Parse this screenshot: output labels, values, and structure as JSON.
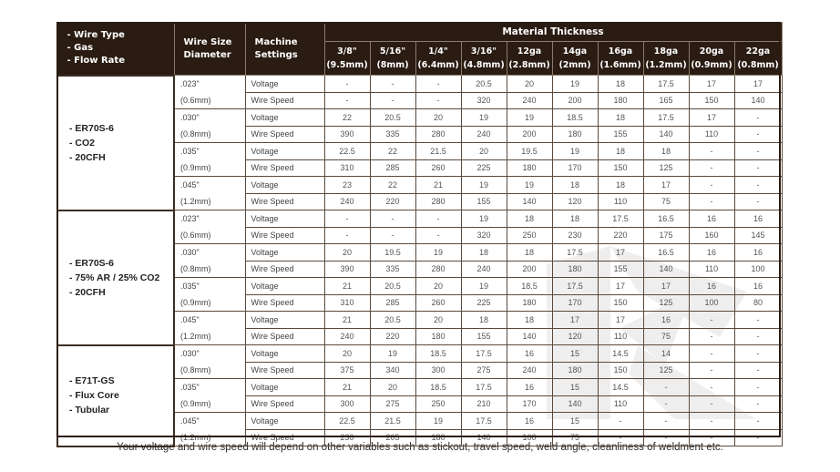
{
  "header": {
    "col1_lines": [
      "- Wire Type",
      "- Gas",
      "- Flow Rate"
    ],
    "col2_lines": [
      "Wire Size",
      "Diameter"
    ],
    "col3_lines": [
      "Machine",
      "Settings"
    ],
    "group_title": "Material Thickness",
    "thickness": [
      {
        "label": "3/8\"",
        "sub": "(9.5mm)"
      },
      {
        "label": "5/16\"",
        "sub": "(8mm)"
      },
      {
        "label": "1/4\"",
        "sub": "(6.4mm)"
      },
      {
        "label": "3/16\"",
        "sub": "(4.8mm)"
      },
      {
        "label": "12ga",
        "sub": "(2.8mm)"
      },
      {
        "label": "14ga",
        "sub": "(2mm)"
      },
      {
        "label": "16ga",
        "sub": "(1.6mm)"
      },
      {
        "label": "18ga",
        "sub": "(1.2mm)"
      },
      {
        "label": "20ga",
        "sub": "(0.9mm)"
      },
      {
        "label": "22ga",
        "sub": "(0.8mm)"
      }
    ]
  },
  "setting_labels": {
    "voltage": "Voltage",
    "wire_speed": "Wire Speed"
  },
  "groups": [
    {
      "lines": [
        "- ER70S-6",
        "- CO2",
        "- 20CFH"
      ],
      "sizes": [
        {
          "in": ".023\"",
          "mm": "(0.6mm)",
          "voltage": [
            "-",
            "-",
            "-",
            "20.5",
            "20",
            "19",
            "18",
            "17.5",
            "17",
            "17"
          ],
          "wire_speed": [
            "-",
            "-",
            "-",
            "320",
            "240",
            "200",
            "180",
            "165",
            "150",
            "140"
          ]
        },
        {
          "in": ".030\"",
          "mm": "(0.8mm)",
          "voltage": [
            "22",
            "20.5",
            "20",
            "19",
            "19",
            "18.5",
            "18",
            "17.5",
            "17",
            "-"
          ],
          "wire_speed": [
            "390",
            "335",
            "280",
            "240",
            "200",
            "180",
            "155",
            "140",
            "110",
            "-"
          ]
        },
        {
          "in": ".035\"",
          "mm": "(0.9mm)",
          "voltage": [
            "22.5",
            "22",
            "21.5",
            "20",
            "19.5",
            "19",
            "18",
            "18",
            "-",
            "-"
          ],
          "wire_speed": [
            "310",
            "285",
            "260",
            "225",
            "180",
            "170",
            "150",
            "125",
            "-",
            "-"
          ]
        },
        {
          "in": ".045\"",
          "mm": "(1.2mm)",
          "voltage": [
            "23",
            "22",
            "21",
            "19",
            "19",
            "18",
            "18",
            "17",
            "-",
            "-"
          ],
          "wire_speed": [
            "240",
            "220",
            "280",
            "155",
            "140",
            "120",
            "110",
            "75",
            "-",
            "-"
          ]
        }
      ]
    },
    {
      "lines": [
        "- ER70S-6",
        "- 75% AR / 25% CO2",
        "- 20CFH"
      ],
      "sizes": [
        {
          "in": ".023\"",
          "mm": "(0.6mm)",
          "voltage": [
            "-",
            "-",
            "-",
            "19",
            "18",
            "18",
            "17.5",
            "16.5",
            "16",
            "16"
          ],
          "wire_speed": [
            "-",
            "-",
            "-",
            "320",
            "250",
            "230",
            "220",
            "175",
            "160",
            "145"
          ]
        },
        {
          "in": ".030\"",
          "mm": "(0.8mm)",
          "voltage": [
            "20",
            "19.5",
            "19",
            "18",
            "18",
            "17.5",
            "17",
            "16.5",
            "16",
            "16"
          ],
          "wire_speed": [
            "390",
            "335",
            "280",
            "240",
            "200",
            "180",
            "155",
            "140",
            "110",
            "100"
          ]
        },
        {
          "in": ".035\"",
          "mm": "(0.9mm)",
          "voltage": [
            "21",
            "20.5",
            "20",
            "19",
            "18.5",
            "17.5",
            "17",
            "17",
            "16",
            "16"
          ],
          "wire_speed": [
            "310",
            "285",
            "260",
            "225",
            "180",
            "170",
            "150",
            "125",
            "100",
            "80"
          ]
        },
        {
          "in": ".045\"",
          "mm": "(1.2mm)",
          "voltage": [
            "21",
            "20.5",
            "20",
            "18",
            "18",
            "17",
            "17",
            "16",
            "-",
            "-"
          ],
          "wire_speed": [
            "240",
            "220",
            "180",
            "155",
            "140",
            "120",
            "110",
            "75",
            "-",
            "-"
          ]
        }
      ]
    },
    {
      "lines": [
        "- E71T-GS",
        "- Flux Core",
        "- Tubular"
      ],
      "sizes": [
        {
          "in": ".030\"",
          "mm": "(0.8mm)",
          "voltage": [
            "20",
            "19",
            "18.5",
            "17.5",
            "16",
            "15",
            "14.5",
            "14",
            "-",
            "-"
          ],
          "wire_speed": [
            "375",
            "340",
            "300",
            "275",
            "240",
            "180",
            "150",
            "125",
            "-",
            "-"
          ]
        },
        {
          "in": ".035\"",
          "mm": "(0.9mm)",
          "voltage": [
            "21",
            "20",
            "18.5",
            "17.5",
            "16",
            "15",
            "14.5",
            "-",
            "-",
            "-"
          ],
          "wire_speed": [
            "300",
            "275",
            "250",
            "210",
            "170",
            "140",
            "110",
            "-",
            "-",
            "-"
          ]
        },
        {
          "in": ".045\"",
          "mm": "(1.2mm)",
          "voltage": [
            "22.5",
            "21.5",
            "19",
            "17.5",
            "16",
            "15",
            "-",
            "-",
            "-",
            "-"
          ],
          "wire_speed": [
            "230",
            "205",
            "180",
            "140",
            "100",
            "75",
            "-",
            "-",
            "-",
            "-"
          ]
        }
      ]
    }
  ],
  "footnote": "Your voltage and wire speed will depend on other variables such as stickout, travel speed, weld angle, cleanliness of weldment etc."
}
